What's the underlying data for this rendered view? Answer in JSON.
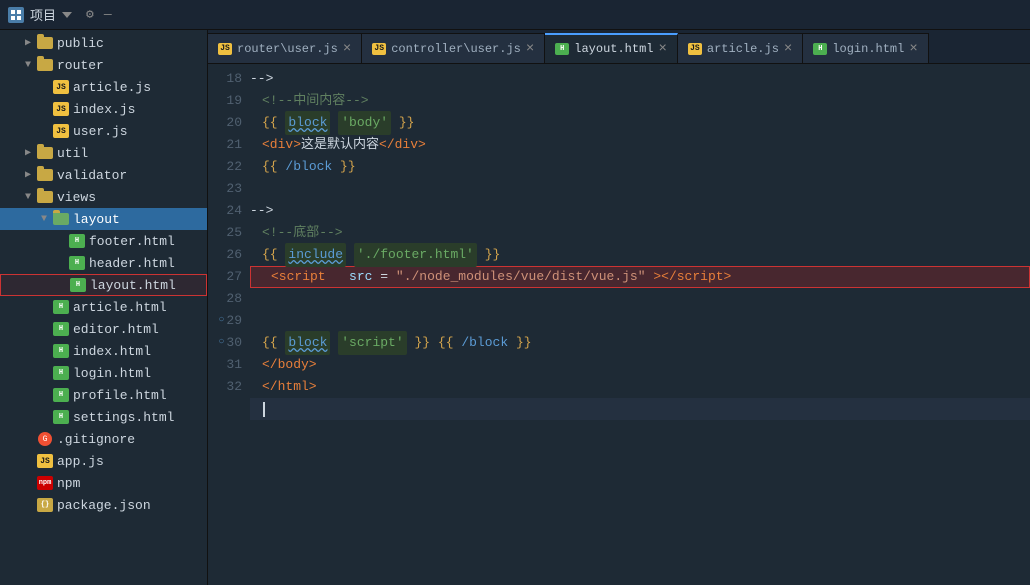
{
  "titlebar": {
    "project_label": "项目",
    "gear_icon": "⚙",
    "minus_icon": "—"
  },
  "sidebar": {
    "items": [
      {
        "id": "public",
        "label": "public",
        "type": "folder",
        "indent": "indent2",
        "arrow": "closed"
      },
      {
        "id": "router",
        "label": "router",
        "type": "folder",
        "indent": "indent2",
        "arrow": "open"
      },
      {
        "id": "article-js",
        "label": "article.js",
        "type": "js",
        "indent": "indent3",
        "arrow": "none"
      },
      {
        "id": "index-js",
        "label": "index.js",
        "type": "js",
        "indent": "indent3",
        "arrow": "none"
      },
      {
        "id": "user-js",
        "label": "user.js",
        "type": "js",
        "indent": "indent3",
        "arrow": "none"
      },
      {
        "id": "util",
        "label": "util",
        "type": "folder",
        "indent": "indent2",
        "arrow": "closed"
      },
      {
        "id": "validator",
        "label": "validator",
        "type": "folder",
        "indent": "indent2",
        "arrow": "closed"
      },
      {
        "id": "views",
        "label": "views",
        "type": "folder",
        "indent": "indent2",
        "arrow": "open"
      },
      {
        "id": "layout-folder",
        "label": "layout",
        "type": "folder",
        "indent": "indent3",
        "arrow": "open",
        "active": true
      },
      {
        "id": "footer-html",
        "label": "footer.html",
        "type": "html-green",
        "indent": "indent4",
        "arrow": "none"
      },
      {
        "id": "header-html",
        "label": "header.html",
        "type": "html-green",
        "indent": "indent4",
        "arrow": "none"
      },
      {
        "id": "layout-html",
        "label": "layout.html",
        "type": "html-green",
        "indent": "indent4",
        "arrow": "none",
        "highlighted": true
      },
      {
        "id": "article-html",
        "label": "article.html",
        "type": "html-green",
        "indent": "indent3",
        "arrow": "none"
      },
      {
        "id": "editor-html",
        "label": "editor.html",
        "type": "html-green",
        "indent": "indent3",
        "arrow": "none"
      },
      {
        "id": "index-html",
        "label": "index.html",
        "type": "html-green",
        "indent": "indent3",
        "arrow": "none"
      },
      {
        "id": "login-html",
        "label": "login.html",
        "type": "html-green",
        "indent": "indent3",
        "arrow": "none"
      },
      {
        "id": "profile-html",
        "label": "profile.html",
        "type": "html-green",
        "indent": "indent3",
        "arrow": "none"
      },
      {
        "id": "settings-html",
        "label": "settings.html",
        "type": "html-green",
        "indent": "indent3",
        "arrow": "none"
      },
      {
        "id": "gitignore",
        "label": ".gitignore",
        "type": "git",
        "indent": "indent2",
        "arrow": "none"
      },
      {
        "id": "app-js",
        "label": "app.js",
        "type": "js",
        "indent": "indent2",
        "arrow": "none"
      },
      {
        "id": "npm",
        "label": "npm",
        "type": "npm",
        "indent": "indent2",
        "arrow": "none"
      },
      {
        "id": "package-json",
        "label": "package.json",
        "type": "json",
        "indent": "indent2",
        "arrow": "none"
      }
    ]
  },
  "tabs": [
    {
      "id": "router-user",
      "label": "router\\user.js",
      "type": "js",
      "active": false
    },
    {
      "id": "controller-user",
      "label": "controller\\user.js",
      "type": "js",
      "active": false
    },
    {
      "id": "layout-html-tab",
      "label": "layout.html",
      "type": "html",
      "active": true
    },
    {
      "id": "article-js-tab",
      "label": "article.js",
      "type": "js",
      "active": false
    },
    {
      "id": "login-html-tab",
      "label": "login.html",
      "type": "html",
      "active": false
    }
  ],
  "code_lines": [
    {
      "num": 18,
      "fold": false,
      "content": "comment_middle",
      "text": "<!--中间内容-->"
    },
    {
      "num": 19,
      "fold": false,
      "content": "block_body",
      "text": ""
    },
    {
      "num": 20,
      "fold": false,
      "content": "div_default",
      "text": "<div>这是默认内容</div>"
    },
    {
      "num": 21,
      "fold": false,
      "content": "endblock",
      "text": "{{ /block }}"
    },
    {
      "num": 22,
      "fold": false,
      "content": "empty",
      "text": ""
    },
    {
      "num": 23,
      "fold": false,
      "content": "comment_bottom",
      "text": "<!--底部-->"
    },
    {
      "num": 24,
      "fold": false,
      "content": "include_footer",
      "text": "{{ include './footer.html' }}"
    },
    {
      "num": 25,
      "fold": false,
      "content": "script_src",
      "text": "<script src=\"./node_modules/vue/dist/vue.js\"><\\/script>",
      "highlighted": true
    },
    {
      "num": 26,
      "fold": false,
      "content": "empty",
      "text": ""
    },
    {
      "num": 27,
      "fold": false,
      "content": "empty",
      "text": ""
    },
    {
      "num": 28,
      "fold": false,
      "content": "block_script",
      "text": ""
    },
    {
      "num": 29,
      "fold": true,
      "content": "end_body",
      "text": "</body>"
    },
    {
      "num": 30,
      "fold": true,
      "content": "end_html",
      "text": "</html>"
    },
    {
      "num": 31,
      "fold": false,
      "content": "cursor",
      "text": ""
    },
    {
      "num": 32,
      "fold": false,
      "content": "empty",
      "text": ""
    }
  ],
  "colors": {
    "bg": "#1e2a35",
    "sidebar_bg": "#1e2a35",
    "tab_active_bg": "#1e2a35",
    "tab_inactive_bg": "#243040",
    "highlight_border": "#cc3333",
    "highlight_bg": "rgba(200,30,30,0.25)",
    "active_folder": "#2d6a9f"
  }
}
